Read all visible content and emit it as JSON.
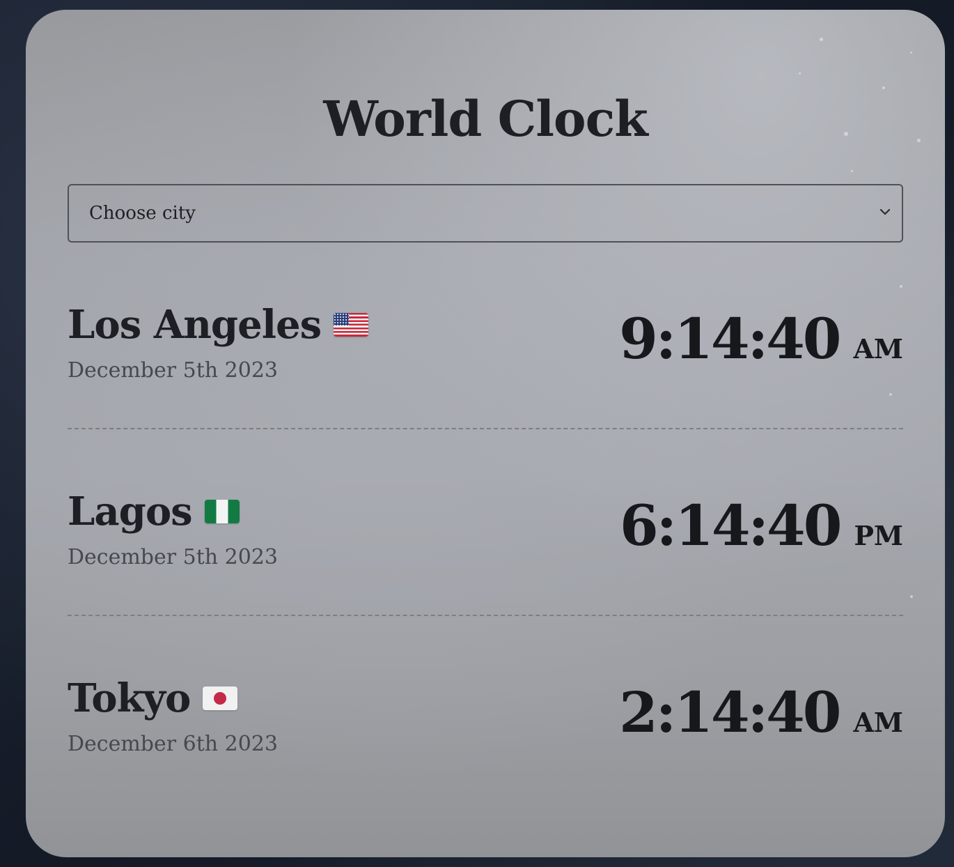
{
  "app": {
    "title": "World Clock"
  },
  "city_select": {
    "selected_label": "Choose city",
    "chevron_icon": "chevron-down-icon"
  },
  "cities": [
    {
      "name": "Los Angeles",
      "flag_icon": "us-flag-icon",
      "date": "December 5th 2023",
      "time": "9:14:40",
      "period": "AM"
    },
    {
      "name": "Lagos",
      "flag_icon": "nigeria-flag-icon",
      "date": "December 5th 2023",
      "time": "6:14:40",
      "period": "PM"
    },
    {
      "name": "Tokyo",
      "flag_icon": "japan-flag-icon",
      "date": "December 6th 2023",
      "time": "2:14:40",
      "period": "AM"
    }
  ],
  "colors": {
    "text_primary": "#1d1f24",
    "text_secondary": "#45484e",
    "card_background": "#a2a5ab",
    "page_background": "#161c28"
  }
}
